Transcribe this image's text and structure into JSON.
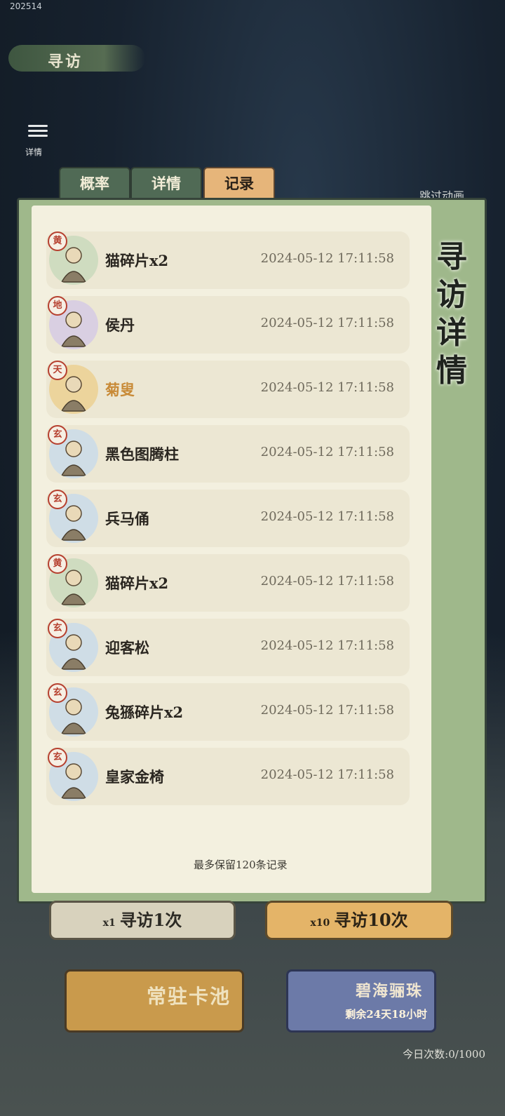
{
  "status": {
    "build": "202514"
  },
  "header": {
    "title": "寻访",
    "menu_label": "详情",
    "skip_label": "跳过动画"
  },
  "tabs": [
    {
      "label": "概率",
      "active": false
    },
    {
      "label": "详情",
      "active": false
    },
    {
      "label": "记录",
      "active": true
    }
  ],
  "panel": {
    "side_title": "寻访详情",
    "footer_note": "最多保留120条记录"
  },
  "records": [
    {
      "rank": "黄",
      "name": "猫碎片x2",
      "time": "2024-05-12  17:11:58",
      "icon": "cat-fragment-icon",
      "highlight": false
    },
    {
      "rank": "地",
      "name": "侯丹",
      "time": "2024-05-12  17:11:58",
      "icon": "character-houdan-icon",
      "highlight": false
    },
    {
      "rank": "天",
      "name": "菊叟",
      "time": "2024-05-12  17:11:58",
      "icon": "character-jusou-icon",
      "highlight": true
    },
    {
      "rank": "玄",
      "name": "黑色图腾柱",
      "time": "2024-05-12  17:11:58",
      "icon": "totem-pole-icon",
      "highlight": false
    },
    {
      "rank": "玄",
      "name": "兵马俑",
      "time": "2024-05-12  17:11:58",
      "icon": "terracotta-warrior-icon",
      "highlight": false
    },
    {
      "rank": "黄",
      "name": "猫碎片x2",
      "time": "2024-05-12  17:11:58",
      "icon": "cat-fragment-icon",
      "highlight": false
    },
    {
      "rank": "玄",
      "name": "迎客松",
      "time": "2024-05-12  17:11:58",
      "icon": "pine-tree-icon",
      "highlight": false
    },
    {
      "rank": "玄",
      "name": "兔猻碎片x2",
      "time": "2024-05-12  17:11:58",
      "icon": "manul-fragment-icon",
      "highlight": false
    },
    {
      "rank": "玄",
      "name": "皇家金椅",
      "time": "2024-05-12  17:11:58",
      "icon": "golden-chair-icon",
      "highlight": false
    }
  ],
  "buttons": {
    "draw_one": {
      "count": "x1",
      "label": "寻访1次"
    },
    "draw_ten": {
      "count": "x10",
      "label": "寻访10次"
    }
  },
  "pools": {
    "standard": {
      "label": "常驻卡池"
    },
    "limited": {
      "label": "碧海骊珠",
      "remaining": "剩余24天18小时"
    }
  },
  "daily": {
    "label": "今日次数:0/1000"
  },
  "colors": {
    "accent": "#e6b57a",
    "panel_green": "#9fb88b",
    "highlight_name": "#c88a36"
  }
}
